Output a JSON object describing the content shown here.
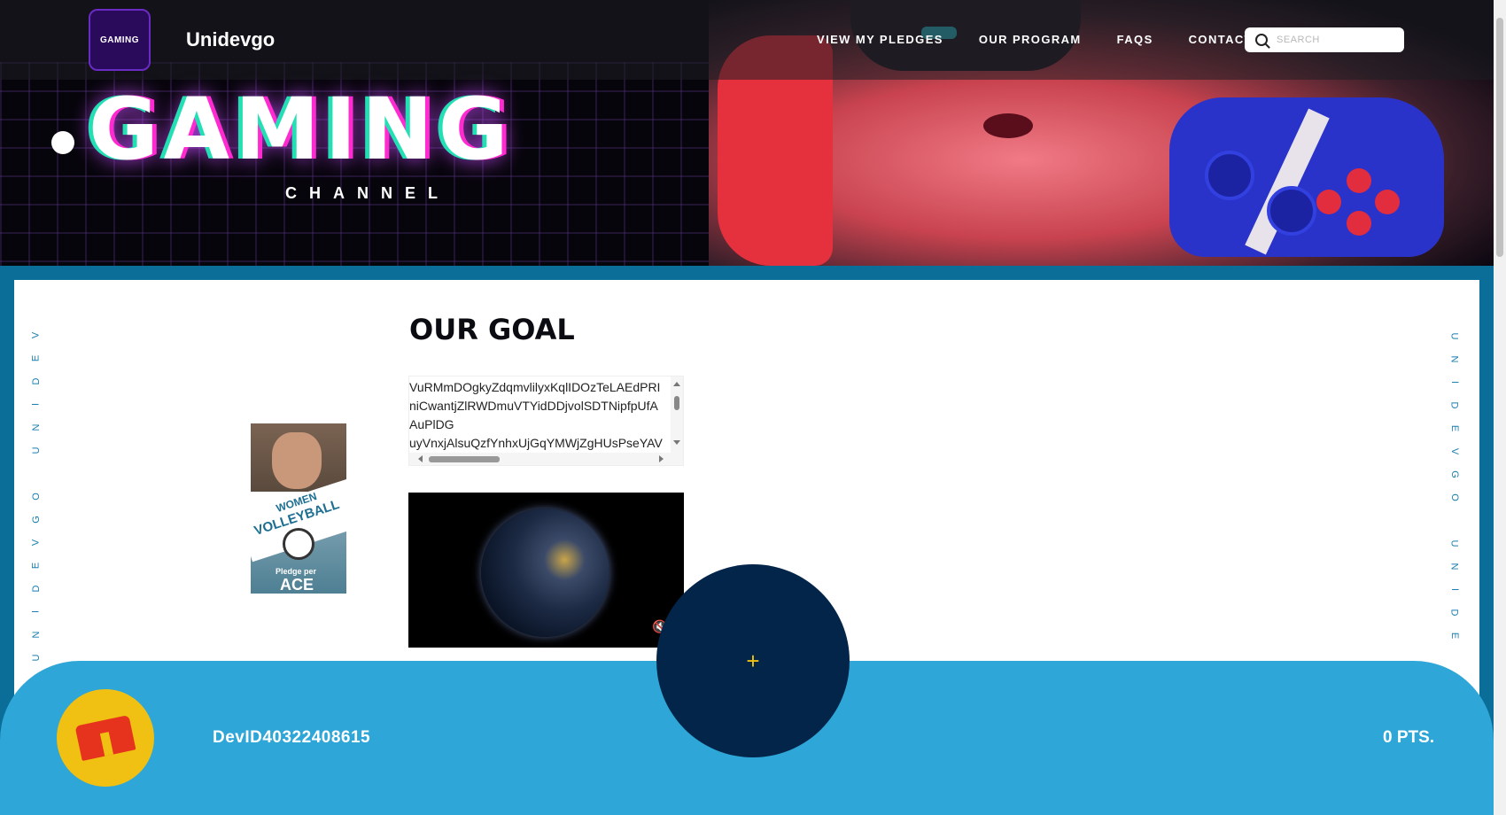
{
  "header": {
    "logo_text": "GAMING",
    "brand": "Unidevgo",
    "nav": [
      {
        "label": "VIEW MY PLEDGES"
      },
      {
        "label": "OUR PROGRAM"
      },
      {
        "label": "FAQS"
      },
      {
        "label": "CONTACT"
      }
    ],
    "search_placeholder": "SEARCH",
    "hero_title": "GAMING",
    "hero_subtitle": "CHANNEL"
  },
  "sidebar_text": "UNIDEVGO UNIDEVGO",
  "main": {
    "goal_title": "OUR GOAL",
    "textbox_lines": [
      "VuRMmDOgkyZdqmvlilyxKqlIDOzTeLAEdPRI",
      "niCwantjZlRWDmuVTYidDDjvolSDTNipfpUfA",
      "AuPlDG",
      "uyVnxjAlsuQzfYnhxUjGqYMWjZgHUsPseYAV"
    ],
    "poster": {
      "line1": "WOMEN",
      "line2": "VOLLEYBALL",
      "line3": "Pledge per",
      "line4": "ACE"
    }
  },
  "footer": {
    "username": "DevID40322408615",
    "points": "0 PTS.",
    "fab_label": "+"
  },
  "colors": {
    "frame": "#0a6e99",
    "bottom_panel": "#2ea6d7",
    "fab": "#03254a",
    "avatar": "#f0c012"
  }
}
